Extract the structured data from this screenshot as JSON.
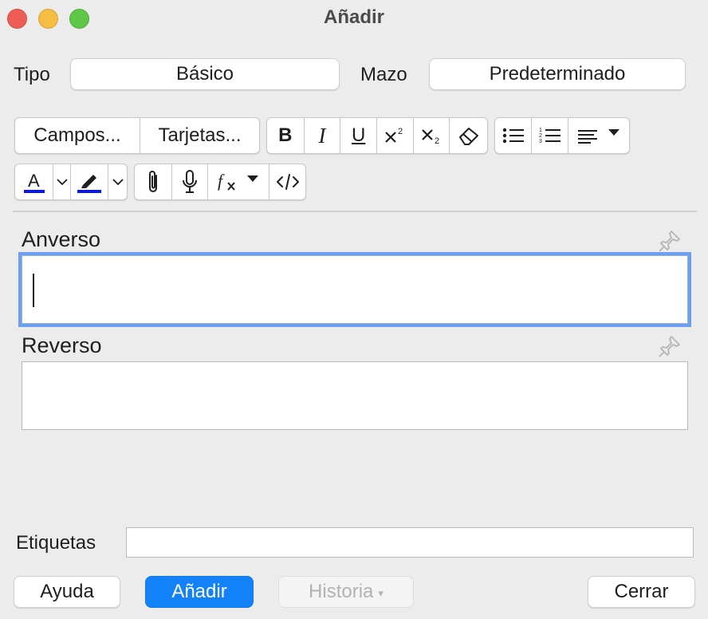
{
  "window": {
    "title": "Añadir"
  },
  "note_type": {
    "label": "Tipo",
    "value": "Básico"
  },
  "deck": {
    "label": "Mazo",
    "value": "Predeterminado"
  },
  "toolbar": {
    "fields_label": "Campos...",
    "cards_label": "Tarjetas...",
    "bold_label": "B",
    "italic_label": "I",
    "underline_label": "U",
    "text_color": "#0a1ad8",
    "highlight_color": "#0a1ad8"
  },
  "fields": [
    {
      "label": "Anverso",
      "value": ""
    },
    {
      "label": "Reverso",
      "value": ""
    }
  ],
  "tags": {
    "label": "Etiquetas",
    "value": ""
  },
  "buttons": {
    "help": "Ayuda",
    "add": "Añadir",
    "history": "Historia",
    "history_arrow": "▾",
    "close": "Cerrar"
  },
  "colors": {
    "accent": "#1382f8",
    "focus_ring": "#6a9ff1"
  }
}
